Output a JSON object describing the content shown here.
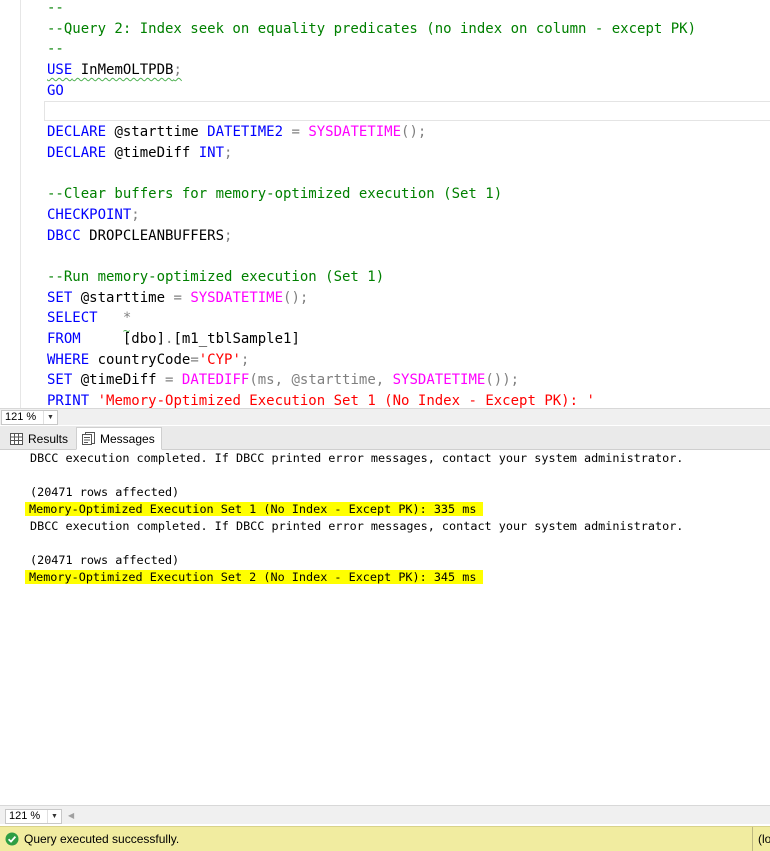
{
  "editor": {
    "lines": [
      [
        {
          "t": "--",
          "c": "cm"
        }
      ],
      [
        {
          "t": "--Query 2: Index seek on equality predicates (no index on column - except PK)",
          "c": "cm"
        }
      ],
      [
        {
          "t": "--",
          "c": "cm"
        }
      ],
      [
        {
          "t": "USE",
          "c": "kw sq"
        },
        {
          "t": " InMemOLTPDB",
          "c": "sq"
        },
        {
          "t": ";",
          "c": "op sq"
        }
      ],
      [
        {
          "t": "GO",
          "c": "kw"
        }
      ],
      [],
      [
        {
          "t": "DECLARE",
          "c": "kw"
        },
        {
          "t": " @starttime "
        },
        {
          "t": "DATETIME2",
          "c": "kw"
        },
        {
          "t": " = ",
          "c": "op"
        },
        {
          "t": "SYSDATETIME",
          "c": "fn"
        },
        {
          "t": "();",
          "c": "op"
        }
      ],
      [
        {
          "t": "DECLARE",
          "c": "kw"
        },
        {
          "t": " @timeDiff "
        },
        {
          "t": "INT",
          "c": "kw"
        },
        {
          "t": ";",
          "c": "op"
        }
      ],
      [],
      [
        {
          "t": "--Clear buffers for memory-optimized execution (Set 1)",
          "c": "cm"
        }
      ],
      [
        {
          "t": "CHECKPOINT",
          "c": "kw"
        },
        {
          "t": ";",
          "c": "op"
        }
      ],
      [
        {
          "t": "DBCC",
          "c": "kw"
        },
        {
          "t": " DROPCLEANBUFFERS"
        },
        {
          "t": ";",
          "c": "op"
        }
      ],
      [],
      [
        {
          "t": "--Run memory-optimized execution (Set 1)",
          "c": "cm"
        }
      ],
      [
        {
          "t": "SET",
          "c": "kw"
        },
        {
          "t": " @starttime "
        },
        {
          "t": "=",
          "c": "op"
        },
        {
          "t": " "
        },
        {
          "t": "SYSDATETIME",
          "c": "fn"
        },
        {
          "t": "();",
          "c": "op"
        }
      ],
      [
        {
          "t": "SELECT",
          "c": "kw"
        },
        {
          "t": "   "
        },
        {
          "t": "*",
          "c": "star"
        }
      ],
      [
        {
          "t": "FROM",
          "c": "kw"
        },
        {
          "t": "     [dbo]"
        },
        {
          "t": ".",
          "c": "op"
        },
        {
          "t": "[m1_tblSample1]"
        }
      ],
      [
        {
          "t": "WHERE",
          "c": "kw"
        },
        {
          "t": " countryCode"
        },
        {
          "t": "=",
          "c": "op"
        },
        {
          "t": "'CYP'",
          "c": "str"
        },
        {
          "t": ";",
          "c": "op"
        }
      ],
      [
        {
          "t": "SET",
          "c": "kw"
        },
        {
          "t": " @timeDiff "
        },
        {
          "t": "=",
          "c": "op"
        },
        {
          "t": " "
        },
        {
          "t": "DATEDIFF",
          "c": "fn"
        },
        {
          "t": "(ms, @starttime, ",
          "c": "op2"
        },
        {
          "t": "SYSDATETIME",
          "c": "fn"
        },
        {
          "t": "());",
          "c": "op"
        }
      ],
      [
        {
          "t": "PRINT",
          "c": "kw"
        },
        {
          "t": " "
        },
        {
          "t": "'Memory-Optimized Execution Set 1 (No Index - Except PK): '",
          "c": "str"
        }
      ]
    ]
  },
  "zoom": {
    "editor_level": "121 %",
    "messages_level": "121 %"
  },
  "tabs": [
    {
      "label": "Results",
      "icon": "grid-icon",
      "active": false
    },
    {
      "label": "Messages",
      "icon": "messages-icon",
      "active": true
    }
  ],
  "messages": {
    "lines": [
      {
        "text": "DBCC execution completed. If DBCC printed error messages, contact your system administrator.",
        "highlight": false
      },
      {
        "text": "",
        "highlight": false
      },
      {
        "text": "(20471 rows affected)",
        "highlight": false
      },
      {
        "text": "Memory-Optimized Execution Set 1 (No Index - Except PK): 335 ms",
        "highlight": true
      },
      {
        "text": "DBCC execution completed. If DBCC printed error messages, contact your system administrator.",
        "highlight": false
      },
      {
        "text": "",
        "highlight": false
      },
      {
        "text": "(20471 rows affected)",
        "highlight": false
      },
      {
        "text": "Memory-Optimized Execution Set 2 (No Index - Except PK): 345 ms",
        "highlight": true
      }
    ]
  },
  "status": {
    "message": "Query executed successfully.",
    "right_text": "(lo",
    "icon": "check-circle-icon",
    "colors": {
      "bar": "#f1eca0",
      "ok": "#2e9e44"
    }
  },
  "highlight_color": "#ffff00"
}
